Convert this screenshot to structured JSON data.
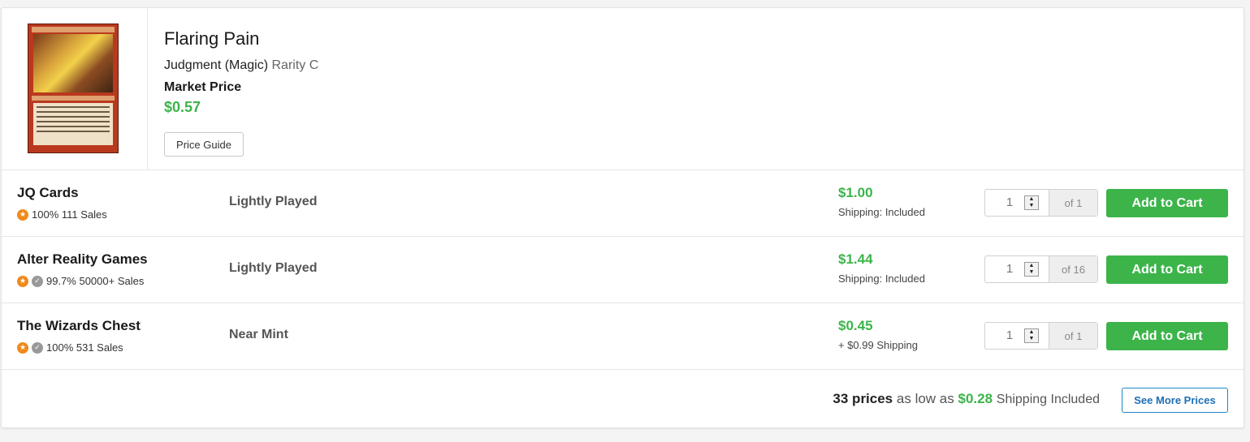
{
  "product": {
    "title": "Flaring Pain",
    "set_name": "Judgment (Magic)",
    "rarity": "Rarity C",
    "market_price_label": "Market Price",
    "market_price": "$0.57",
    "price_guide_label": "Price Guide",
    "image_icon": "card-art"
  },
  "listings": [
    {
      "seller": "JQ Cards",
      "rating": "100% 111 Sales",
      "badges": [
        "star"
      ],
      "condition": "Lightly Played",
      "price": "$1.00",
      "shipping": "Shipping: Included",
      "qty": "1",
      "available": "of 1",
      "cta": "Add to Cart"
    },
    {
      "seller": "Alter Reality Games",
      "rating": "99.7% 50000+ Sales",
      "badges": [
        "star",
        "check"
      ],
      "condition": "Lightly Played",
      "price": "$1.44",
      "shipping": "Shipping: Included",
      "qty": "1",
      "available": "of 16",
      "cta": "Add to Cart"
    },
    {
      "seller": "The Wizards Chest",
      "rating": "100% 531 Sales",
      "badges": [
        "star",
        "check"
      ],
      "condition": "Near Mint",
      "price": "$0.45",
      "shipping": "+ $0.99 Shipping",
      "qty": "1",
      "available": "of 1",
      "cta": "Add to Cart"
    }
  ],
  "footer": {
    "count": "33 prices",
    "as_low_as": "as low as",
    "lowest": "$0.28",
    "shipping_incl": "Shipping Included",
    "see_more_label": "See More Prices"
  },
  "colors": {
    "accent_green": "#3cb44a",
    "star_orange": "#f08a1c",
    "link_blue": "#1e6fb5"
  }
}
